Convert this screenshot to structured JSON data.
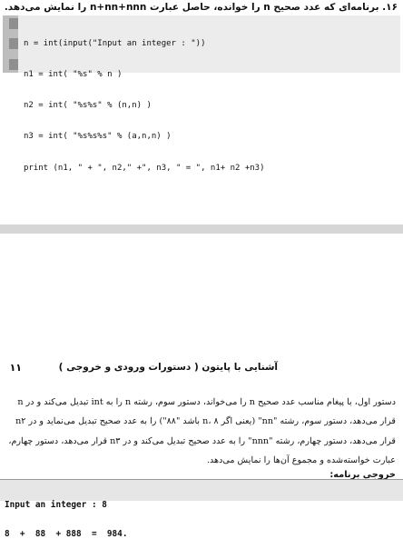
{
  "exercise": {
    "title": "۱۶. برنامه‌ای که عدد صحیح n را خوانده، حاصل عبارت n+nn+nnn را نمایش می‌دهد."
  },
  "code": {
    "lines": [
      "n = int(input(\"Input an integer : \"))",
      "n1 = int( \"%s\" % n )",
      "n2 = int( \"%s%s\" % (n,n) )",
      "n3 = int( \"%s%s%s\" % (a,n,n) )",
      "print (n1, \" + \", n2,\" +\", n3, \" = \", n1+ n2 +n3)"
    ]
  },
  "footer_header": {
    "chapter_title": "آشنایی با پایتون ( دستورات ورودی و خروجی )",
    "page_number": "۱۱"
  },
  "explanation": {
    "lines": [
      "دستور اول، با پیغام مناسب عدد صحیح n را می‌خواند، دستور سوم، رشته n را به int تبدیل می‌کند و در n",
      "قرار می‌دهد، دستور سوم، رشته \"nn\" (یعنی اگر n، ۸ باشد \"۸۸\") را به عدد صحیح تبدیل می‌نماید و در n۲",
      "قرار می‌دهد، دستور چهارم، رشته \"nnn\" را به عدد صحیح تبدیل می‌کند و در n۳ قرار می‌دهد، دستور چهارم،",
      "عبارت خواسته‌شده و مجموع آن‌ها را نمایش می‌دهد."
    ]
  },
  "output": {
    "label": "خروجی برنامه:",
    "lines": [
      "Input an integer : 8",
      "8  +  88  + 888  =  984."
    ]
  }
}
